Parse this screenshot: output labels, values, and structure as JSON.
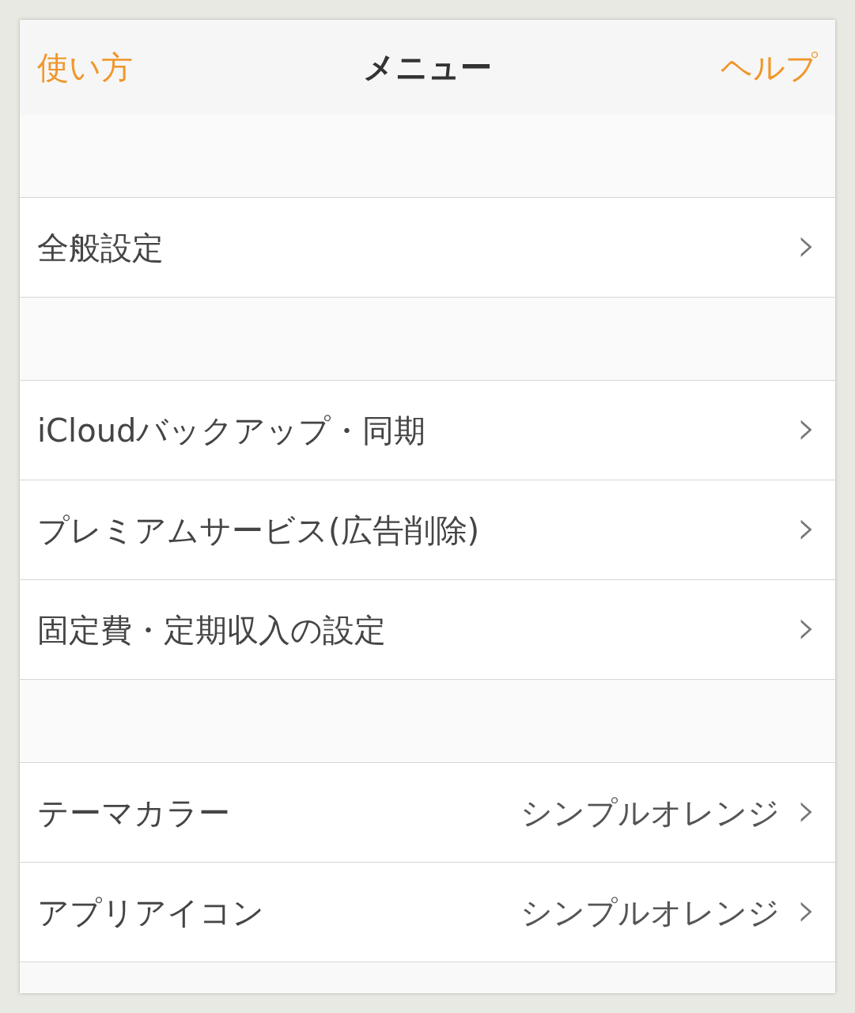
{
  "nav_bar": {
    "left_button": "使い方",
    "title": "メニュー",
    "right_button": "ヘルプ"
  },
  "sections": [
    {
      "rows": [
        {
          "label": "全般設定",
          "chevron": "›"
        }
      ]
    },
    {
      "rows": [
        {
          "label": "iCloudバックアップ・同期",
          "chevron": "›"
        },
        {
          "label": "プレミアムサービス(広告削除)",
          "chevron": "›"
        },
        {
          "label": "固定費・定期収入の設定",
          "chevron": "›"
        }
      ]
    },
    {
      "rows": [
        {
          "label": "テーマカラー",
          "value": "シンプルオレンジ",
          "chevron": "›"
        },
        {
          "label": "アプリアイコン",
          "value": "シンプルオレンジ",
          "chevron": "›"
        }
      ]
    }
  ]
}
